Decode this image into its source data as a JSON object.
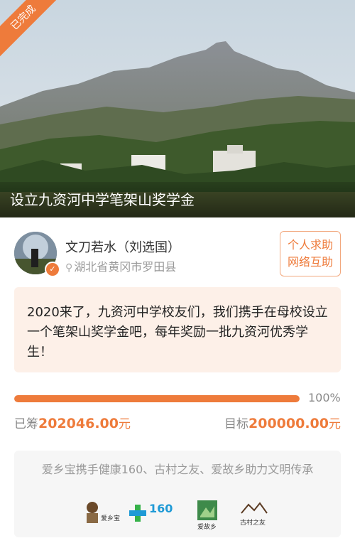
{
  "hero": {
    "ribbon_label": "已完成",
    "title": "设立九资河中学笔架山奖学金"
  },
  "organizer": {
    "name": "文刀若水（刘选国）",
    "location": "湖北省黄冈市罗田县",
    "avatar_icon": "avatar",
    "verified_icon": "verified-check-icon",
    "location_icon": "location-pin-icon"
  },
  "tag": {
    "line1": "个人求助",
    "line2": "网络互助"
  },
  "description": "2020来了，九资河中学校友们，我们携手在母校设立一个笔架山奖学金吧，每年奖励一批九资河优秀学生！",
  "progress": {
    "percent_label": "100%",
    "fill_fraction": 1.0
  },
  "funding": {
    "raised_label": "已筹",
    "raised_amount": "202046.00",
    "raised_unit": "元",
    "target_label": "目标",
    "target_amount": "200000.00",
    "target_unit": "元"
  },
  "sponsor": {
    "text": "爱乡宝携手健康160、古村之友、爱故乡助力文明传承",
    "logos": [
      {
        "icon": "aixiangbao-logo",
        "caption": "爱乡宝"
      },
      {
        "icon": "health160-logo",
        "caption": "160"
      },
      {
        "icon": "aiguxiang-logo",
        "caption": "爱故乡"
      },
      {
        "icon": "gucunzhiyou-logo",
        "caption": "古村之友"
      }
    ]
  },
  "colors": {
    "accent": "#ee7b3b",
    "accent_light": "#fdf0e8",
    "muted": "#999999"
  }
}
